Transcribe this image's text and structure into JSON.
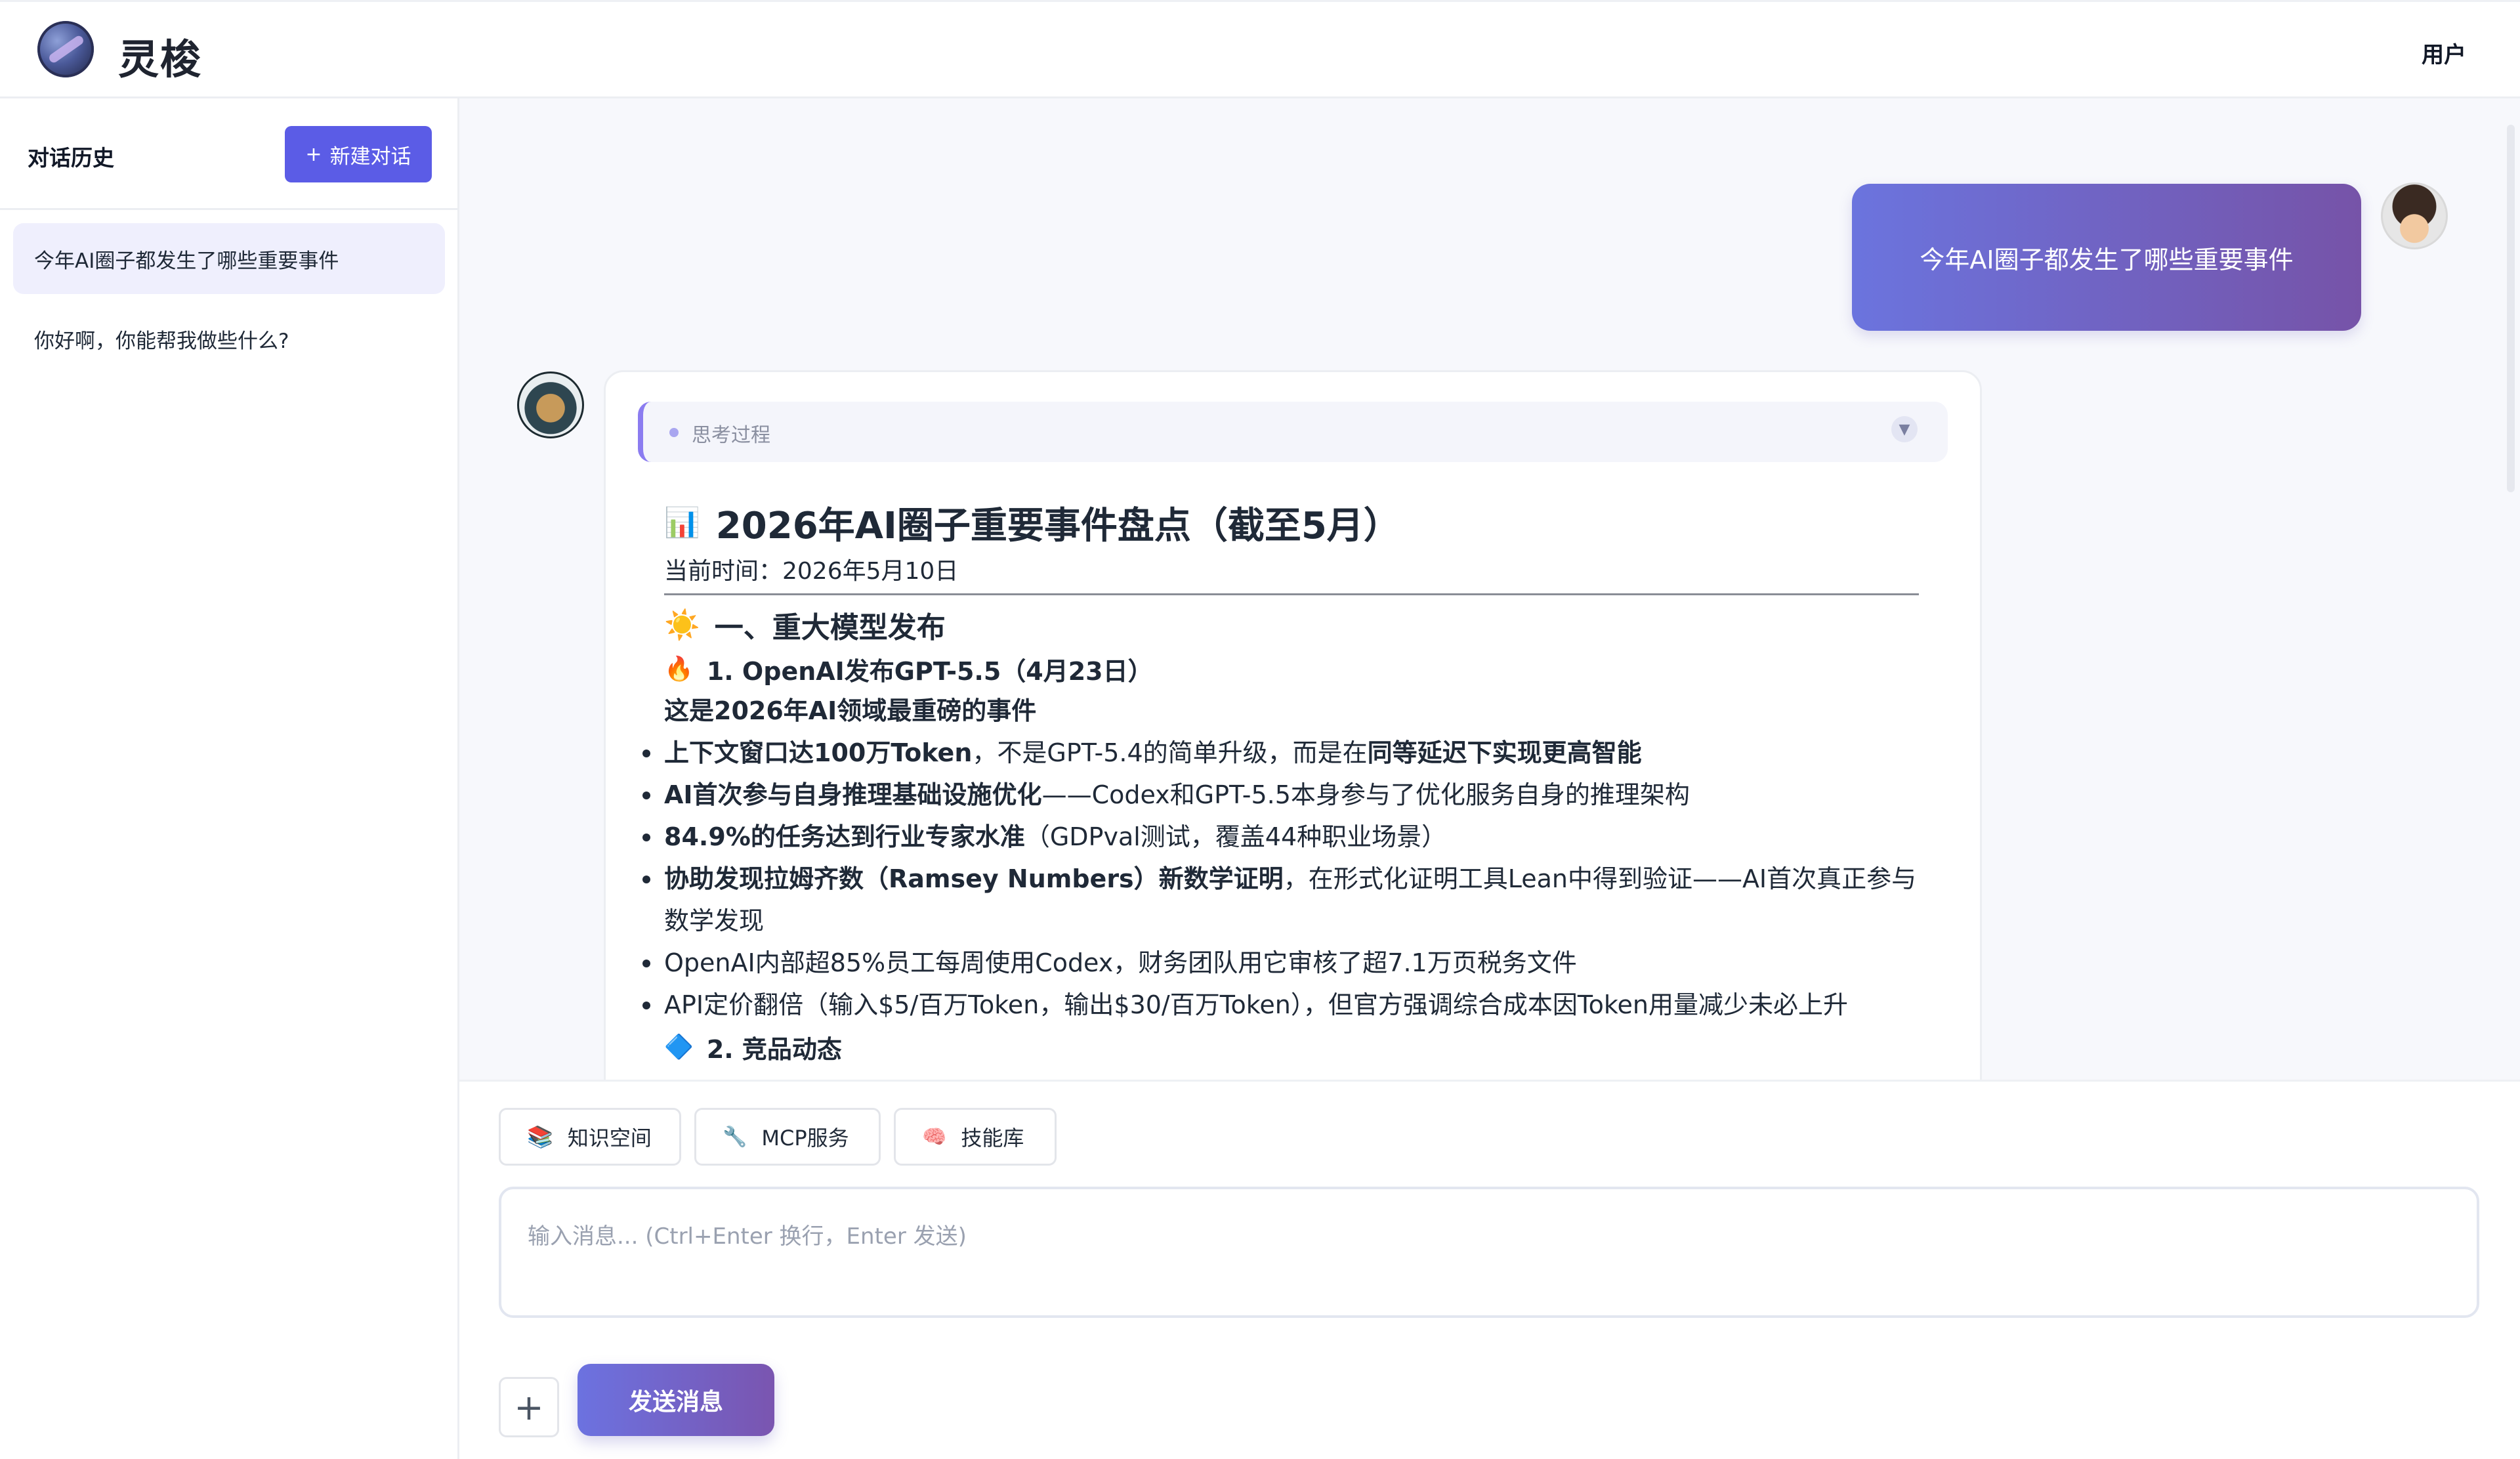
{
  "header": {
    "app_title": "灵梭",
    "user_label": "用户"
  },
  "sidebar": {
    "title": "对话历史",
    "new_chat_label": "新建对话",
    "items": [
      {
        "label": "今年AI圈子都发生了哪些重要事件",
        "active": true
      },
      {
        "label": "你好啊，你能帮我做些什么?",
        "active": false
      }
    ]
  },
  "chat": {
    "user_message": "今年AI圈子都发生了哪些重要事件",
    "thinking_label": "思考过程",
    "answer": {
      "title": "2026年AI圈子重要事件盘点（截至5月）",
      "title_icon": "📊",
      "current_time": "当前时间：2026年5月10日",
      "section1": {
        "icon": "☀️",
        "label": "一、重大模型发布"
      },
      "item1": {
        "icon": "🔥",
        "label": "1. OpenAI发布GPT-5.5（4月23日）",
        "lead": "这是2026年AI领域最重磅的事件",
        "bullets": [
          {
            "bold": "上下文窗口达100万Token",
            "text": "，不是GPT-5.4的简单升级，而是在",
            "bold2": "同等延迟下实现更高智能"
          },
          {
            "bold": "AI首次参与自身推理基础设施优化",
            "text": "——Codex和GPT-5.5本身参与了优化服务自身的推理架构",
            "bold2": ""
          },
          {
            "bold": "84.9%的任务达到行业专家水准",
            "text": "（GDPval测试，覆盖44种职业场景）",
            "bold2": ""
          },
          {
            "bold": "协助发现拉姆齐数（Ramsey Numbers）新数学证明",
            "text": "，在形式化证明工具Lean中得到验证——AI首次真正参与数学发现",
            "bold2": ""
          },
          {
            "bold": "",
            "text": "OpenAI内部超85%员工每周使用Codex，财务团队用它审核了超7.1万页税务文件",
            "bold2": ""
          },
          {
            "bold": "",
            "text": "API定价翻倍（输入$5/百万Token，输出$30/百万Token），但官方强调综合成本因Token用量减少未必上升",
            "bold2": ""
          }
        ]
      },
      "item2": {
        "icon": "🔷",
        "label": "2. 竞品动态"
      }
    }
  },
  "composer": {
    "tools": [
      {
        "label": "知识空间",
        "icon": "books-icon"
      },
      {
        "label": "MCP服务",
        "icon": "wrench-icon"
      },
      {
        "label": "技能库",
        "icon": "brain-icon"
      }
    ],
    "placeholder": "输入消息... (Ctrl+Enter 换行，Enter 发送)",
    "plus_label": "+",
    "send_label": "发送消息"
  },
  "colors": {
    "accent": "#5b5ce6",
    "bubble_start": "#6b74de",
    "bubble_end": "#7653a8",
    "thinking_bar": "#8b7cf0"
  }
}
